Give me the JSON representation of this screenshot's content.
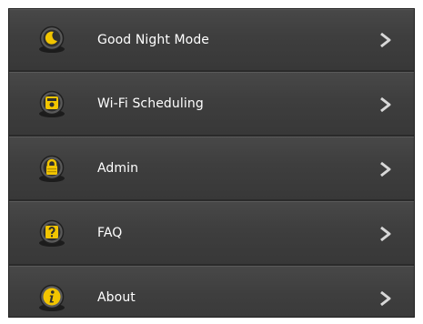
{
  "menu": {
    "items": [
      {
        "label": "Good Night Mode",
        "icon": "moon-icon"
      },
      {
        "label": "Wi-Fi Scheduling",
        "icon": "calendar-icon"
      },
      {
        "label": "Admin",
        "icon": "lock-icon"
      },
      {
        "label": "FAQ",
        "icon": "question-icon"
      },
      {
        "label": "About",
        "icon": "info-icon"
      }
    ]
  },
  "colors": {
    "background": "#3b3b3b",
    "accent": "#f2c500",
    "text": "#ffffff",
    "chevron": "#d8d8d8"
  }
}
